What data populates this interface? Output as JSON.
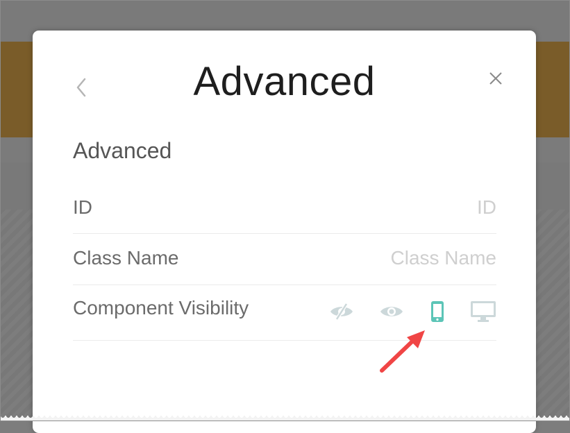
{
  "modal": {
    "title": "Advanced",
    "back_icon": "chevron-left-icon",
    "close_icon": "close-icon"
  },
  "section": {
    "heading": "Advanced"
  },
  "fields": {
    "id": {
      "label": "ID",
      "value": "",
      "placeholder": "ID"
    },
    "class_name": {
      "label": "Class Name",
      "value": "",
      "placeholder": "Class Name"
    }
  },
  "visibility": {
    "label": "Component Visibility",
    "options": [
      {
        "name": "hidden",
        "icon": "eye-slash-icon"
      },
      {
        "name": "visible",
        "icon": "eye-icon"
      },
      {
        "name": "mobile",
        "icon": "mobile-icon",
        "selected": true
      },
      {
        "name": "desktop",
        "icon": "desktop-icon"
      }
    ]
  },
  "colors": {
    "accent": "#5cc5b7",
    "icon_inactive": "#ccd8da",
    "annotation_arrow": "#f04545",
    "backdrop_gold": "#7a5c29"
  }
}
